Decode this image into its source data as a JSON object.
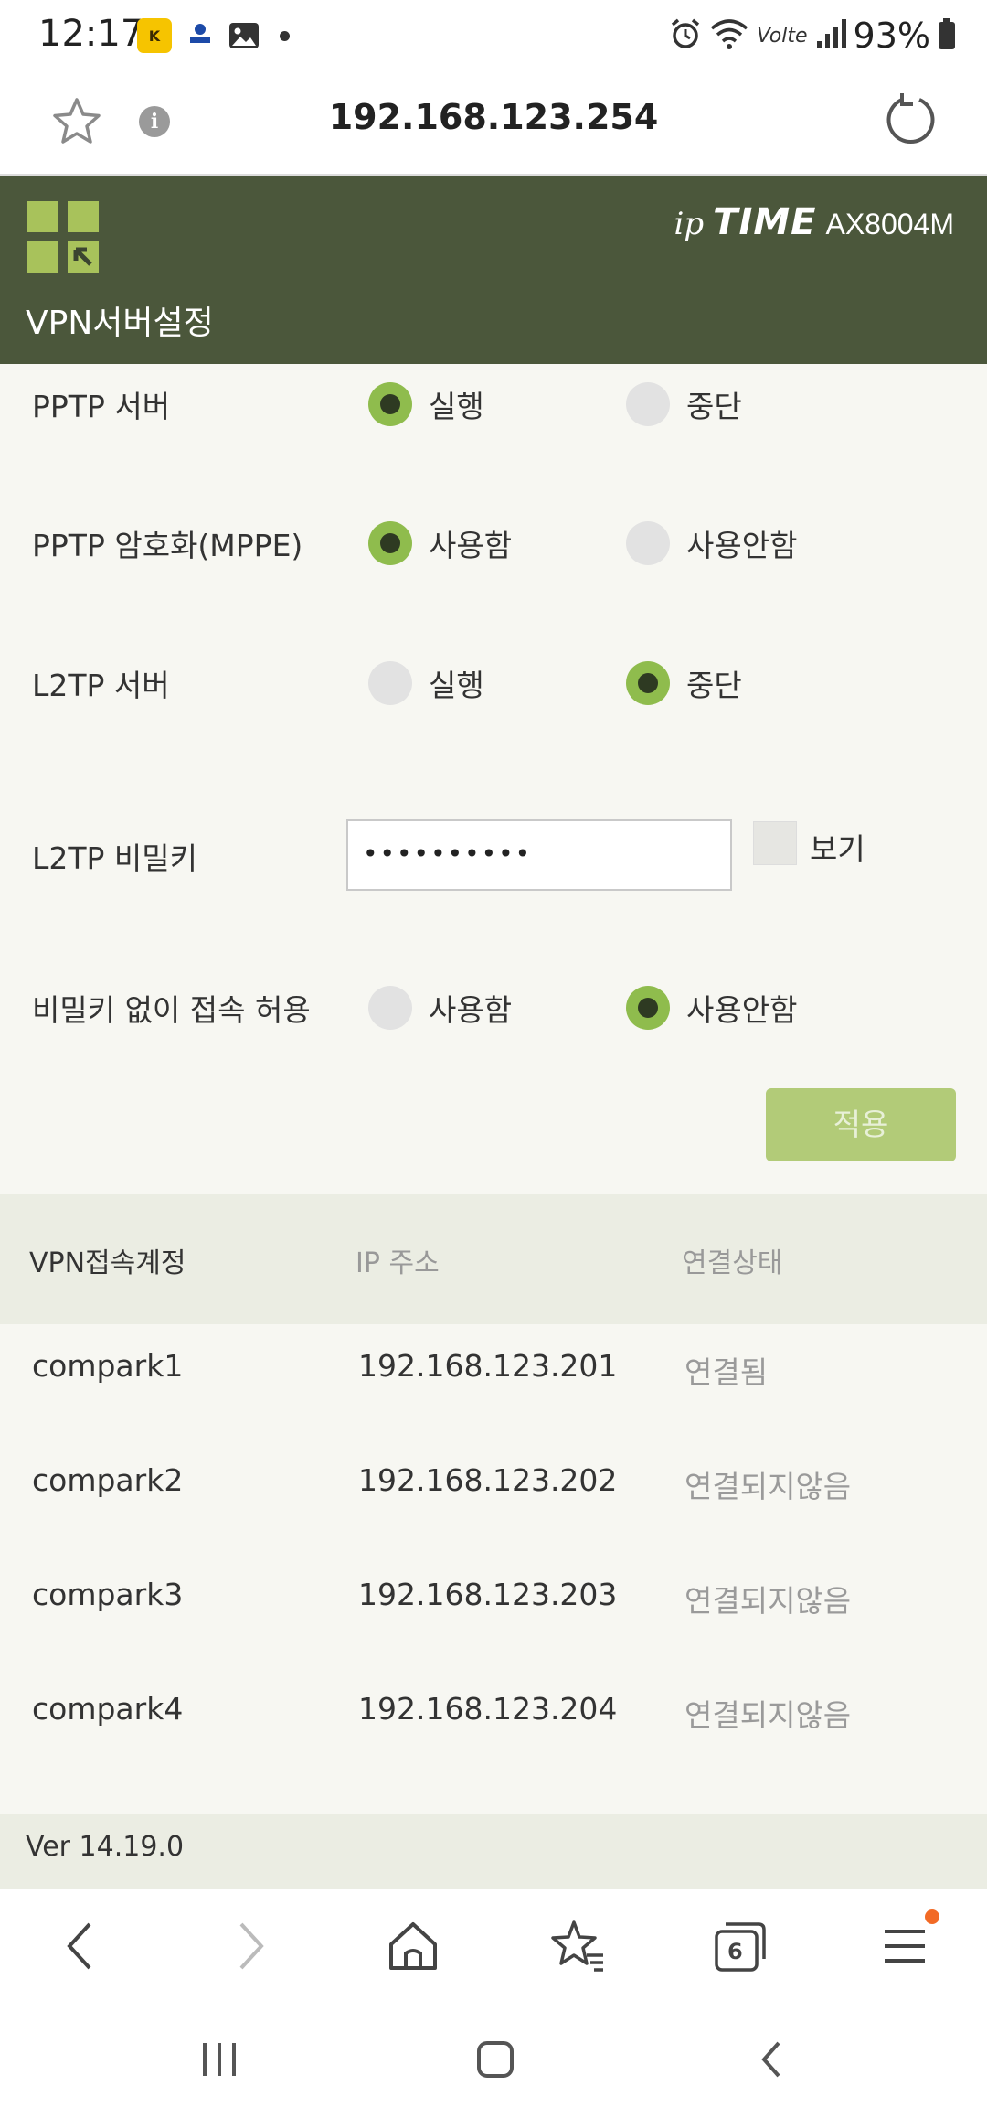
{
  "status_bar": {
    "time": "12:17",
    "battery": "93%",
    "icons": [
      "kakao-notification-icon",
      "won-app-notification-icon",
      "gallery-notification-icon",
      "alarm-icon",
      "wifi-icon",
      "volte-icon",
      "signal-icon",
      "battery-icon"
    ],
    "volte_label": "Volte"
  },
  "browser": {
    "url": "192.168.123.254",
    "tab_count": "6",
    "info_glyph": "i"
  },
  "router": {
    "brand_ip": "ip",
    "brand_time": "TIME",
    "model": "AX8004M",
    "page_title": "VPN서버설정",
    "accent_color": "#8fbc4d",
    "header_color": "#4b573b"
  },
  "settings": [
    {
      "label": "PPTP 서버",
      "options": [
        "실행",
        "중단"
      ],
      "selected": 0
    },
    {
      "label": "PPTP 암호화(MPPE)",
      "options": [
        "사용함",
        "사용안함"
      ],
      "selected": 0
    },
    {
      "label": "L2TP 서버",
      "options": [
        "실행",
        "중단"
      ],
      "selected": 1
    },
    {
      "label": "L2TP 비밀키",
      "value": "••••••••••",
      "show_label": "보기"
    },
    {
      "label": "비밀키 없이 접속 허용",
      "options": [
        "사용함",
        "사용안함"
      ],
      "selected": 1
    }
  ],
  "apply_label": "적용",
  "table": {
    "headers": [
      "VPN접속계정",
      "IP 주소",
      "연결상태"
    ],
    "rows": [
      [
        "compark1",
        "192.168.123.201",
        "연결됨"
      ],
      [
        "compark2",
        "192.168.123.202",
        "연결되지않음"
      ],
      [
        "compark3",
        "192.168.123.203",
        "연결되지않음"
      ],
      [
        "compark4",
        "192.168.123.204",
        "연결되지않음"
      ]
    ]
  },
  "footer": {
    "version": "Ver 14.19.0"
  }
}
